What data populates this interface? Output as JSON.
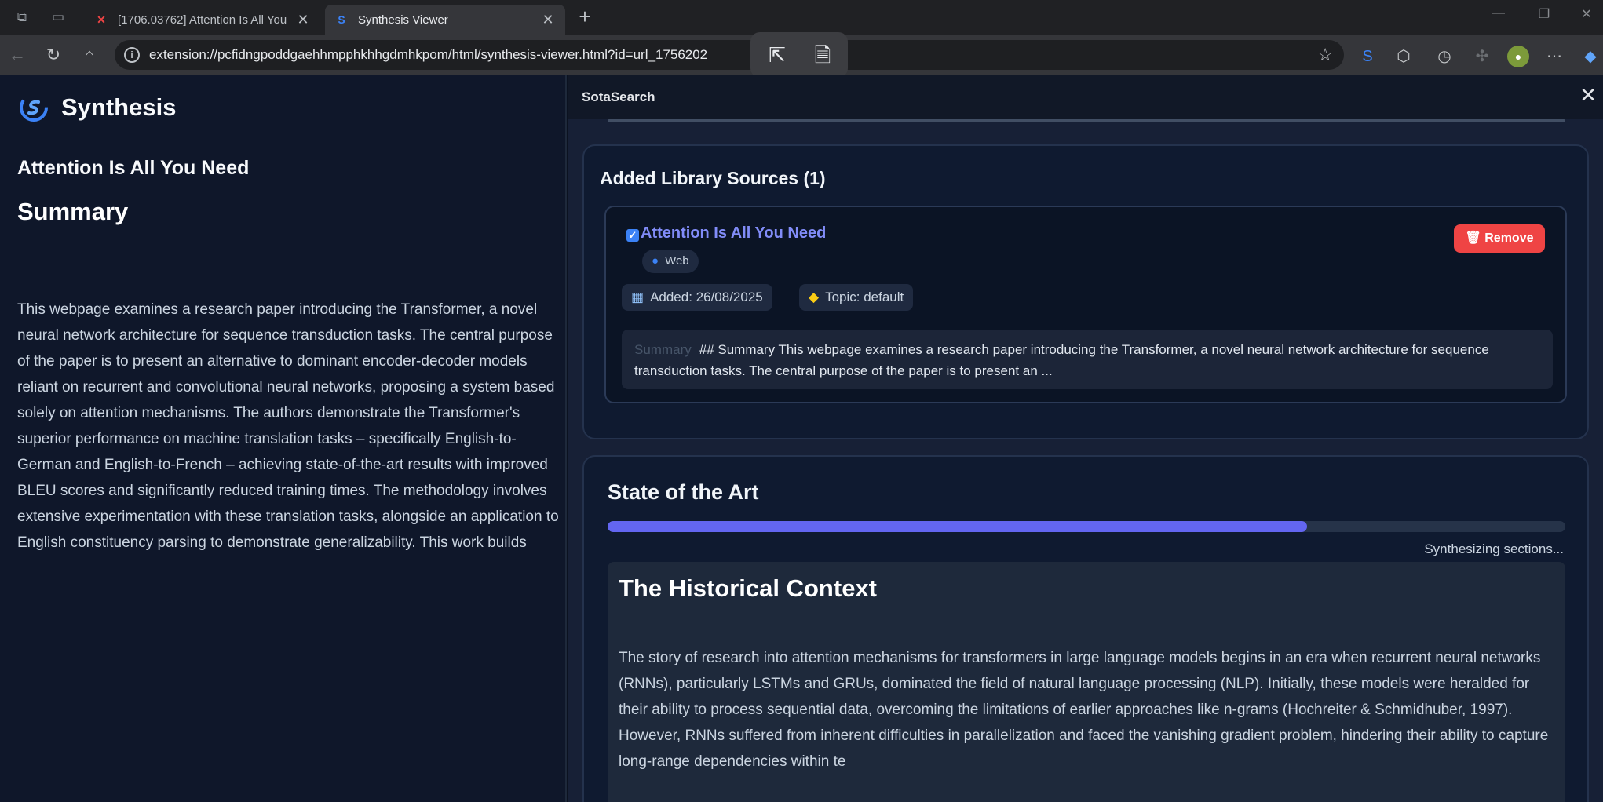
{
  "browser": {
    "tabs": [
      {
        "title": "[1706.03762] Attention Is All You",
        "favicon": "arxiv-icon",
        "active": false
      },
      {
        "title": "Synthesis Viewer",
        "favicon": "synthesis-icon",
        "active": true
      }
    ],
    "url": "extension://pcfidngpoddgaehhmpphkhhgdmhkpom/html/synthesis-viewer.html?id=url_1756202"
  },
  "sidebar": {
    "brand": "Synthesis",
    "paper_title": "Attention Is All You Need",
    "summary_heading": "Summary",
    "summary_text": "This webpage examines a research paper introducing the Transformer, a novel neural network architecture for sequence transduction tasks. The central purpose of the paper is to present an alternative to dominant encoder-decoder models reliant on recurrent and convolutional neural networks, proposing a system based solely on attention mechanisms. The authors demonstrate the Transformer's superior performance on machine translation tasks – specifically English-to-German and English-to-French – achieving state-of-the-art results with improved BLEU scores and significantly reduced training times. The methodology involves extensive experimentation with these translation tasks, alongside an application to English constituency parsing to demonstrate generalizability. This work builds"
  },
  "panel": {
    "title": "SotaSearch",
    "library": {
      "heading": "Added Library Sources (1)",
      "source": {
        "title": "Attention Is All You Need",
        "type_chip": "Web",
        "added": "Added: 26/08/2025",
        "topic": "Topic: default",
        "remove_label": "Remove",
        "snippet_label": "Summary",
        "snippet": "## Summary This webpage examines a research paper introducing the Transformer, a novel neural network architecture for sequence transduction tasks. The central purpose of the paper is to present an ..."
      }
    },
    "sota": {
      "heading": "State of the Art",
      "progress": 0.73,
      "status": "Synthesizing sections...",
      "section_title": "The Historical Context",
      "section_text": "The story of research into attention mechanisms for transformers in large language models begins in an era when recurrent neural networks (RNNs), particularly LSTMs and GRUs, dominated the field of natural language processing (NLP). Initially, these models were heralded for their ability to process sequential data, overcoming the limitations of earlier approaches like n-grams (Hochreiter & Schmidhuber, 1997). However, RNNs suffered from inherent difficulties in parallelization and faced the vanishing gradient problem, hindering their ability to capture long-range dependencies within te"
    }
  },
  "colors": {
    "accent": "#6366f1",
    "remove": "#ef4444",
    "source_title": "#818cf8"
  }
}
